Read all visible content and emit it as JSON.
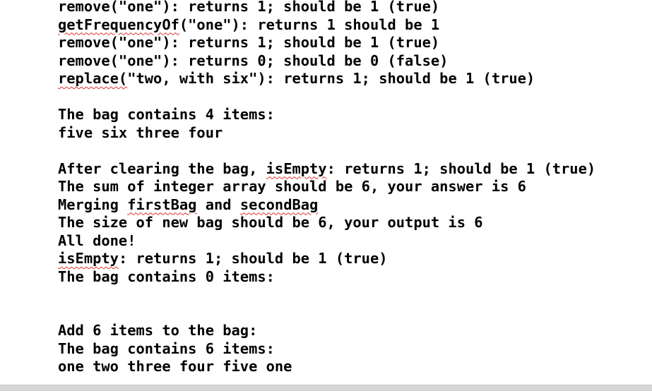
{
  "console": {
    "lines": [
      [
        "remove(\"one\"): returns 1; should be 1 (true)"
      ],
      [
        {
          "t": "getFrequencyOf",
          "sp": true
        },
        "(\"one\"): returns 1 should be 1"
      ],
      [
        "remove(\"one\"): returns 1; should be 1 (true)"
      ],
      [
        "remove(\"one\"): returns 0; should be 0 (false)"
      ],
      [
        {
          "t": "replace(",
          "sp": true
        },
        "\"two, with six\"): returns 1; should be 1 (true)"
      ],
      [
        ""
      ],
      [
        "The bag contains 4 items:"
      ],
      [
        "five six three four"
      ],
      [
        ""
      ],
      [
        "After clearing the bag, ",
        {
          "t": "isEmpty",
          "sp": true
        },
        ": returns 1; should be 1 (true)"
      ],
      [
        "The sum of integer array should be 6, your answer is 6"
      ],
      [
        "Merging ",
        {
          "t": "firstBag",
          "sp": true
        },
        " and ",
        {
          "t": "secondBag",
          "sp": true
        }
      ],
      [
        "The size of new bag should be 6, your output is 6"
      ],
      [
        "All done!"
      ],
      [
        {
          "t": "isEmpty",
          "sp": true
        },
        ": returns 1; should be 1 (true)"
      ],
      [
        "The bag contains 0 items:"
      ],
      [
        ""
      ],
      [
        ""
      ],
      [
        "Add 6 items to the bag:"
      ],
      [
        "The bag contains 6 items:"
      ],
      [
        "one two three four five one"
      ]
    ]
  },
  "colors": {
    "background": "#ffffff",
    "text": "#000000",
    "spellcheck_underline": "#e03030",
    "scrollbar": "#d6d6d6"
  }
}
